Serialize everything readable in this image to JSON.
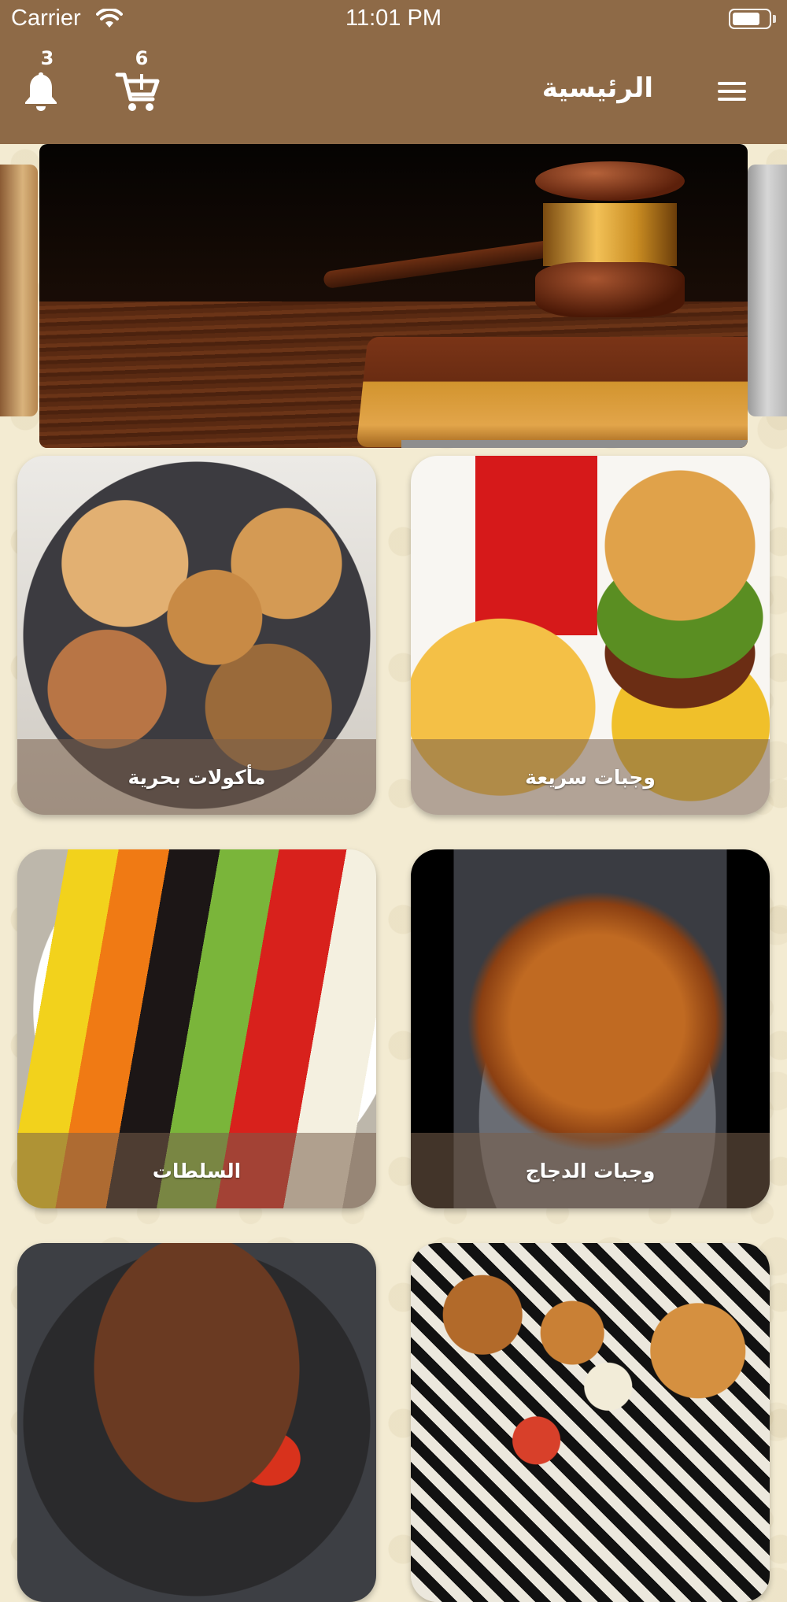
{
  "status_bar": {
    "carrier": "Carrier",
    "time": "11:01 PM",
    "wifi_icon": "wifi-icon",
    "battery_icon": "battery-icon"
  },
  "nav": {
    "title": "الرئيسية",
    "menu_icon": "hamburger-menu-icon",
    "notifications": {
      "icon": "bell-icon",
      "count": "3"
    },
    "cart": {
      "icon": "cart-icon",
      "count": "6"
    }
  },
  "banner": {
    "image": "gavel-on-book"
  },
  "categories": [
    {
      "label": "مأكولات بحرية",
      "image": "seafood-platter"
    },
    {
      "label": "وجبات سريعة",
      "image": "burger-fries-drink"
    },
    {
      "label": "السلطات",
      "image": "cobb-salad"
    },
    {
      "label": "وجبات الدجاج",
      "image": "roast-chicken"
    },
    {
      "label": "",
      "image": "grilled-steak"
    },
    {
      "label": "",
      "image": "fried-appetizers-onion-rings"
    }
  ],
  "colors": {
    "header": "#8e6a47",
    "background": "#f3ebd2",
    "card_label_overlay": "rgba(120,95,75,0.55)"
  }
}
